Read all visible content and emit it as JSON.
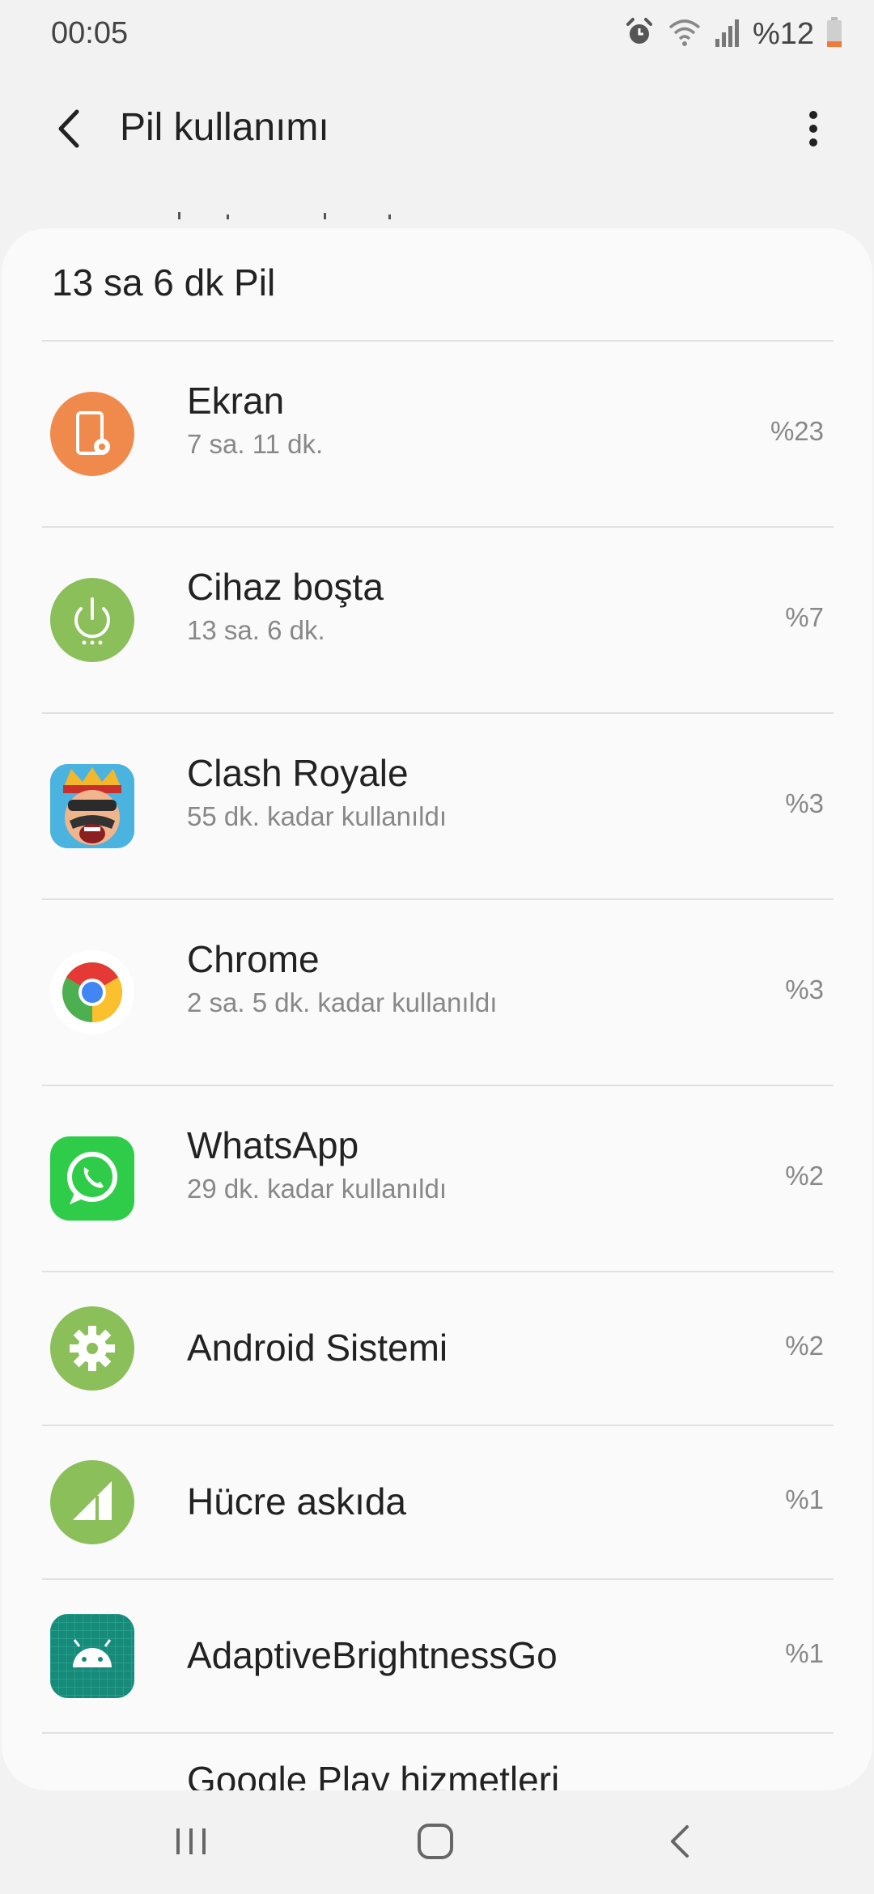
{
  "status_bar": {
    "time": "00:05",
    "battery": "%12",
    "icons": [
      "alarm-icon",
      "wifi-icon",
      "signal-icon",
      "battery-icon"
    ]
  },
  "header": {
    "title": "Pil kullanımı",
    "back_icon": "back-arrow-icon",
    "menu_icon": "more-vert-icon"
  },
  "summary": "13 sa 6 dk Pil",
  "items": [
    {
      "name": "Ekran",
      "detail": "7 sa. 11 dk.",
      "percent": "%23",
      "icon": "screen-icon",
      "color": "#ef8a4c"
    },
    {
      "name": "Cihaz boşta",
      "detail": "13 sa. 6 dk.",
      "percent": "%7",
      "icon": "power-idle-icon",
      "color": "#8bbf5a"
    },
    {
      "name": "Clash Royale",
      "detail": "55 dk. kadar kullanıldı",
      "percent": "%3",
      "icon": "clash-royale-icon",
      "color": "#3aa8d8"
    },
    {
      "name": "Chrome",
      "detail": "2 sa. 5 dk. kadar kullanıldı",
      "percent": "%3",
      "icon": "chrome-icon",
      "color": "#ffffff"
    },
    {
      "name": "WhatsApp",
      "detail": "29 dk. kadar kullanıldı",
      "percent": "%2",
      "icon": "whatsapp-icon",
      "color": "#2ecc49"
    },
    {
      "name": "Android Sistemi",
      "detail": "",
      "percent": "%2",
      "icon": "android-system-gear-icon",
      "color": "#8bbf5a"
    },
    {
      "name": "Hücre askıda",
      "detail": "",
      "percent": "%1",
      "icon": "cell-standby-icon",
      "color": "#8bbf5a"
    },
    {
      "name": "AdaptiveBrightnessGo",
      "detail": "",
      "percent": "%1",
      "icon": "android-app-icon",
      "color": "#178a7a"
    },
    {
      "name": "Google Play hizmetleri",
      "detail": "",
      "percent": "",
      "icon": "google-play-services-icon",
      "color": "#23c46b"
    }
  ],
  "nav": {
    "recents_icon": "recents-icon",
    "home_icon": "home-icon",
    "back_icon": "nav-back-icon"
  }
}
